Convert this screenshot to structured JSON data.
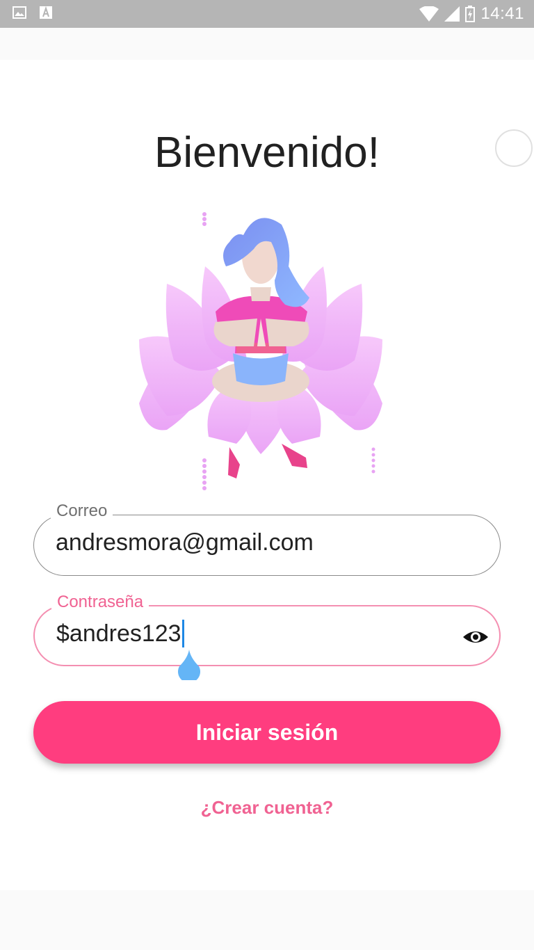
{
  "status_bar": {
    "time": "14:41",
    "left_icons": [
      "image-icon",
      "font-icon"
    ],
    "right_icons": [
      "wifi-icon",
      "signal-icon",
      "battery-charging-icon"
    ]
  },
  "screen": {
    "title": "Bienvenido!",
    "illustration": "meditating-woman-lotus"
  },
  "form": {
    "email": {
      "label": "Correo",
      "value": "andresmora@gmail.com"
    },
    "password": {
      "label": "Contraseña",
      "value": "$andres123",
      "focused": true,
      "visibility_icon": "eye-icon"
    },
    "login_label": "Iniciar sesión",
    "signup_label": "¿Crear cuenta?"
  },
  "colors": {
    "accent": "#ff3d7f",
    "link": "#f06292",
    "focus_border": "#f48fb1",
    "caret": "#1e88e5",
    "status_bar": "#b5b5b5"
  }
}
